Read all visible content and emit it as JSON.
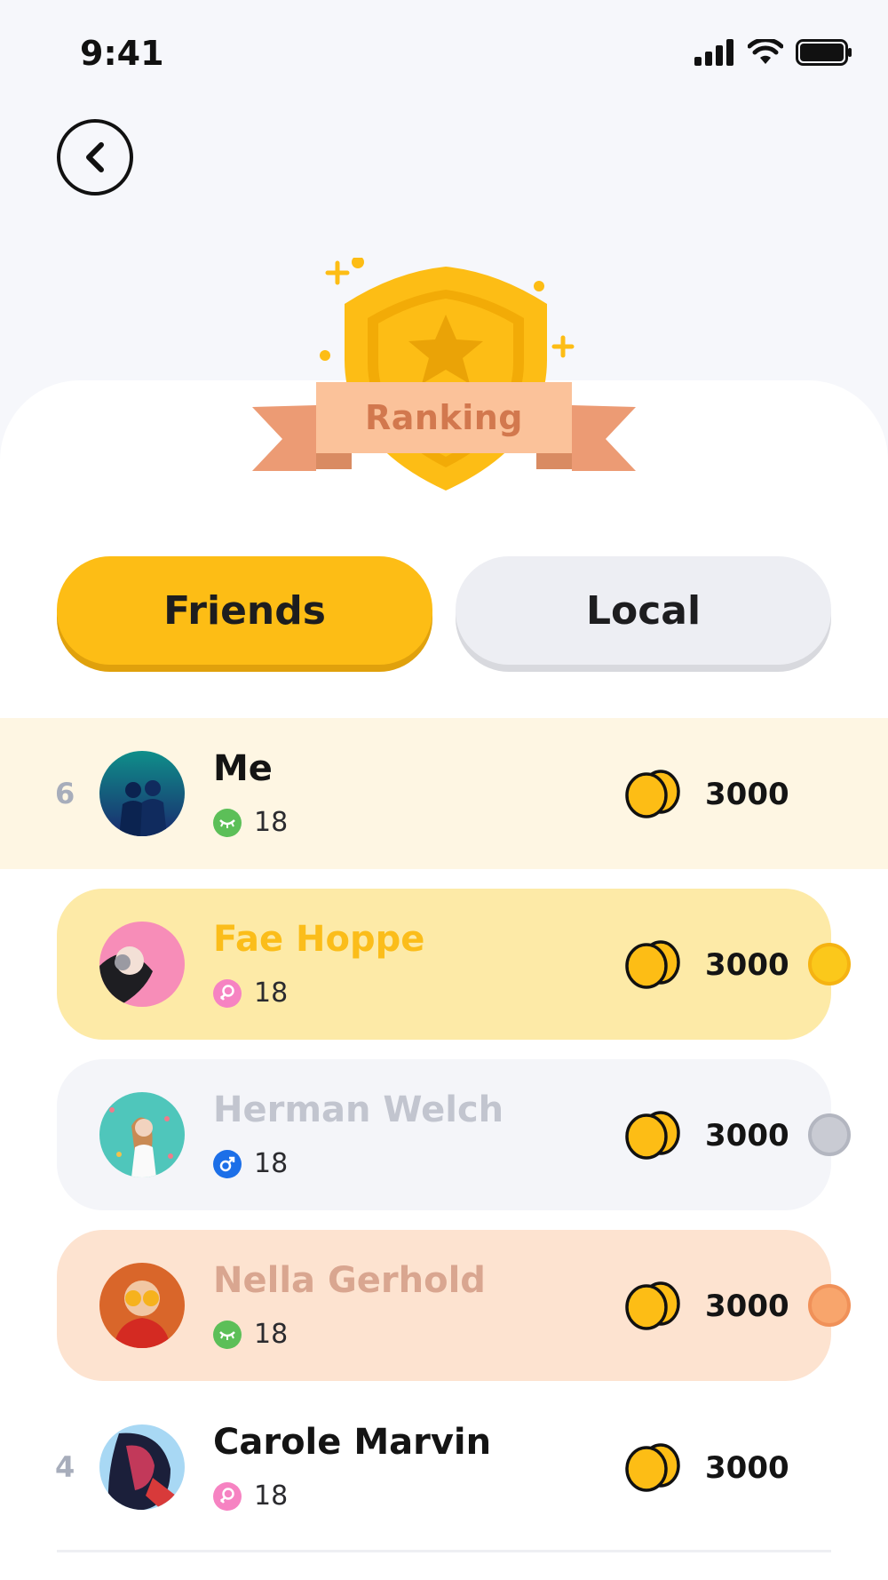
{
  "status_bar": {
    "time": "9:41"
  },
  "badge": {
    "label": "Ranking"
  },
  "tabs": {
    "friends": "Friends",
    "local": "Local"
  },
  "colors": {
    "accent": "#fdbd15",
    "gold_row": "#fdeaa7",
    "silver_row": "#f4f5f9",
    "bronze_row": "#fde3d0",
    "me_row": "#fef6e3"
  },
  "me": {
    "rank": "6",
    "name": "Me",
    "gender_icon": "eyelash-icon",
    "age": "18",
    "score": "3000"
  },
  "players": [
    {
      "name": "Fae Hoppe",
      "gender_icon": "female-icon",
      "age": "18",
      "score": "3000",
      "medal": "gold"
    },
    {
      "name": "Herman Welch",
      "gender_icon": "male-icon",
      "age": "18",
      "score": "3000",
      "medal": "silver"
    },
    {
      "name": "Nella Gerhold",
      "gender_icon": "eyelash-icon",
      "age": "18",
      "score": "3000",
      "medal": "bronze"
    },
    {
      "rank": "4",
      "name": "Carole Marvin",
      "gender_icon": "female-icon",
      "age": "18",
      "score": "3000"
    }
  ]
}
